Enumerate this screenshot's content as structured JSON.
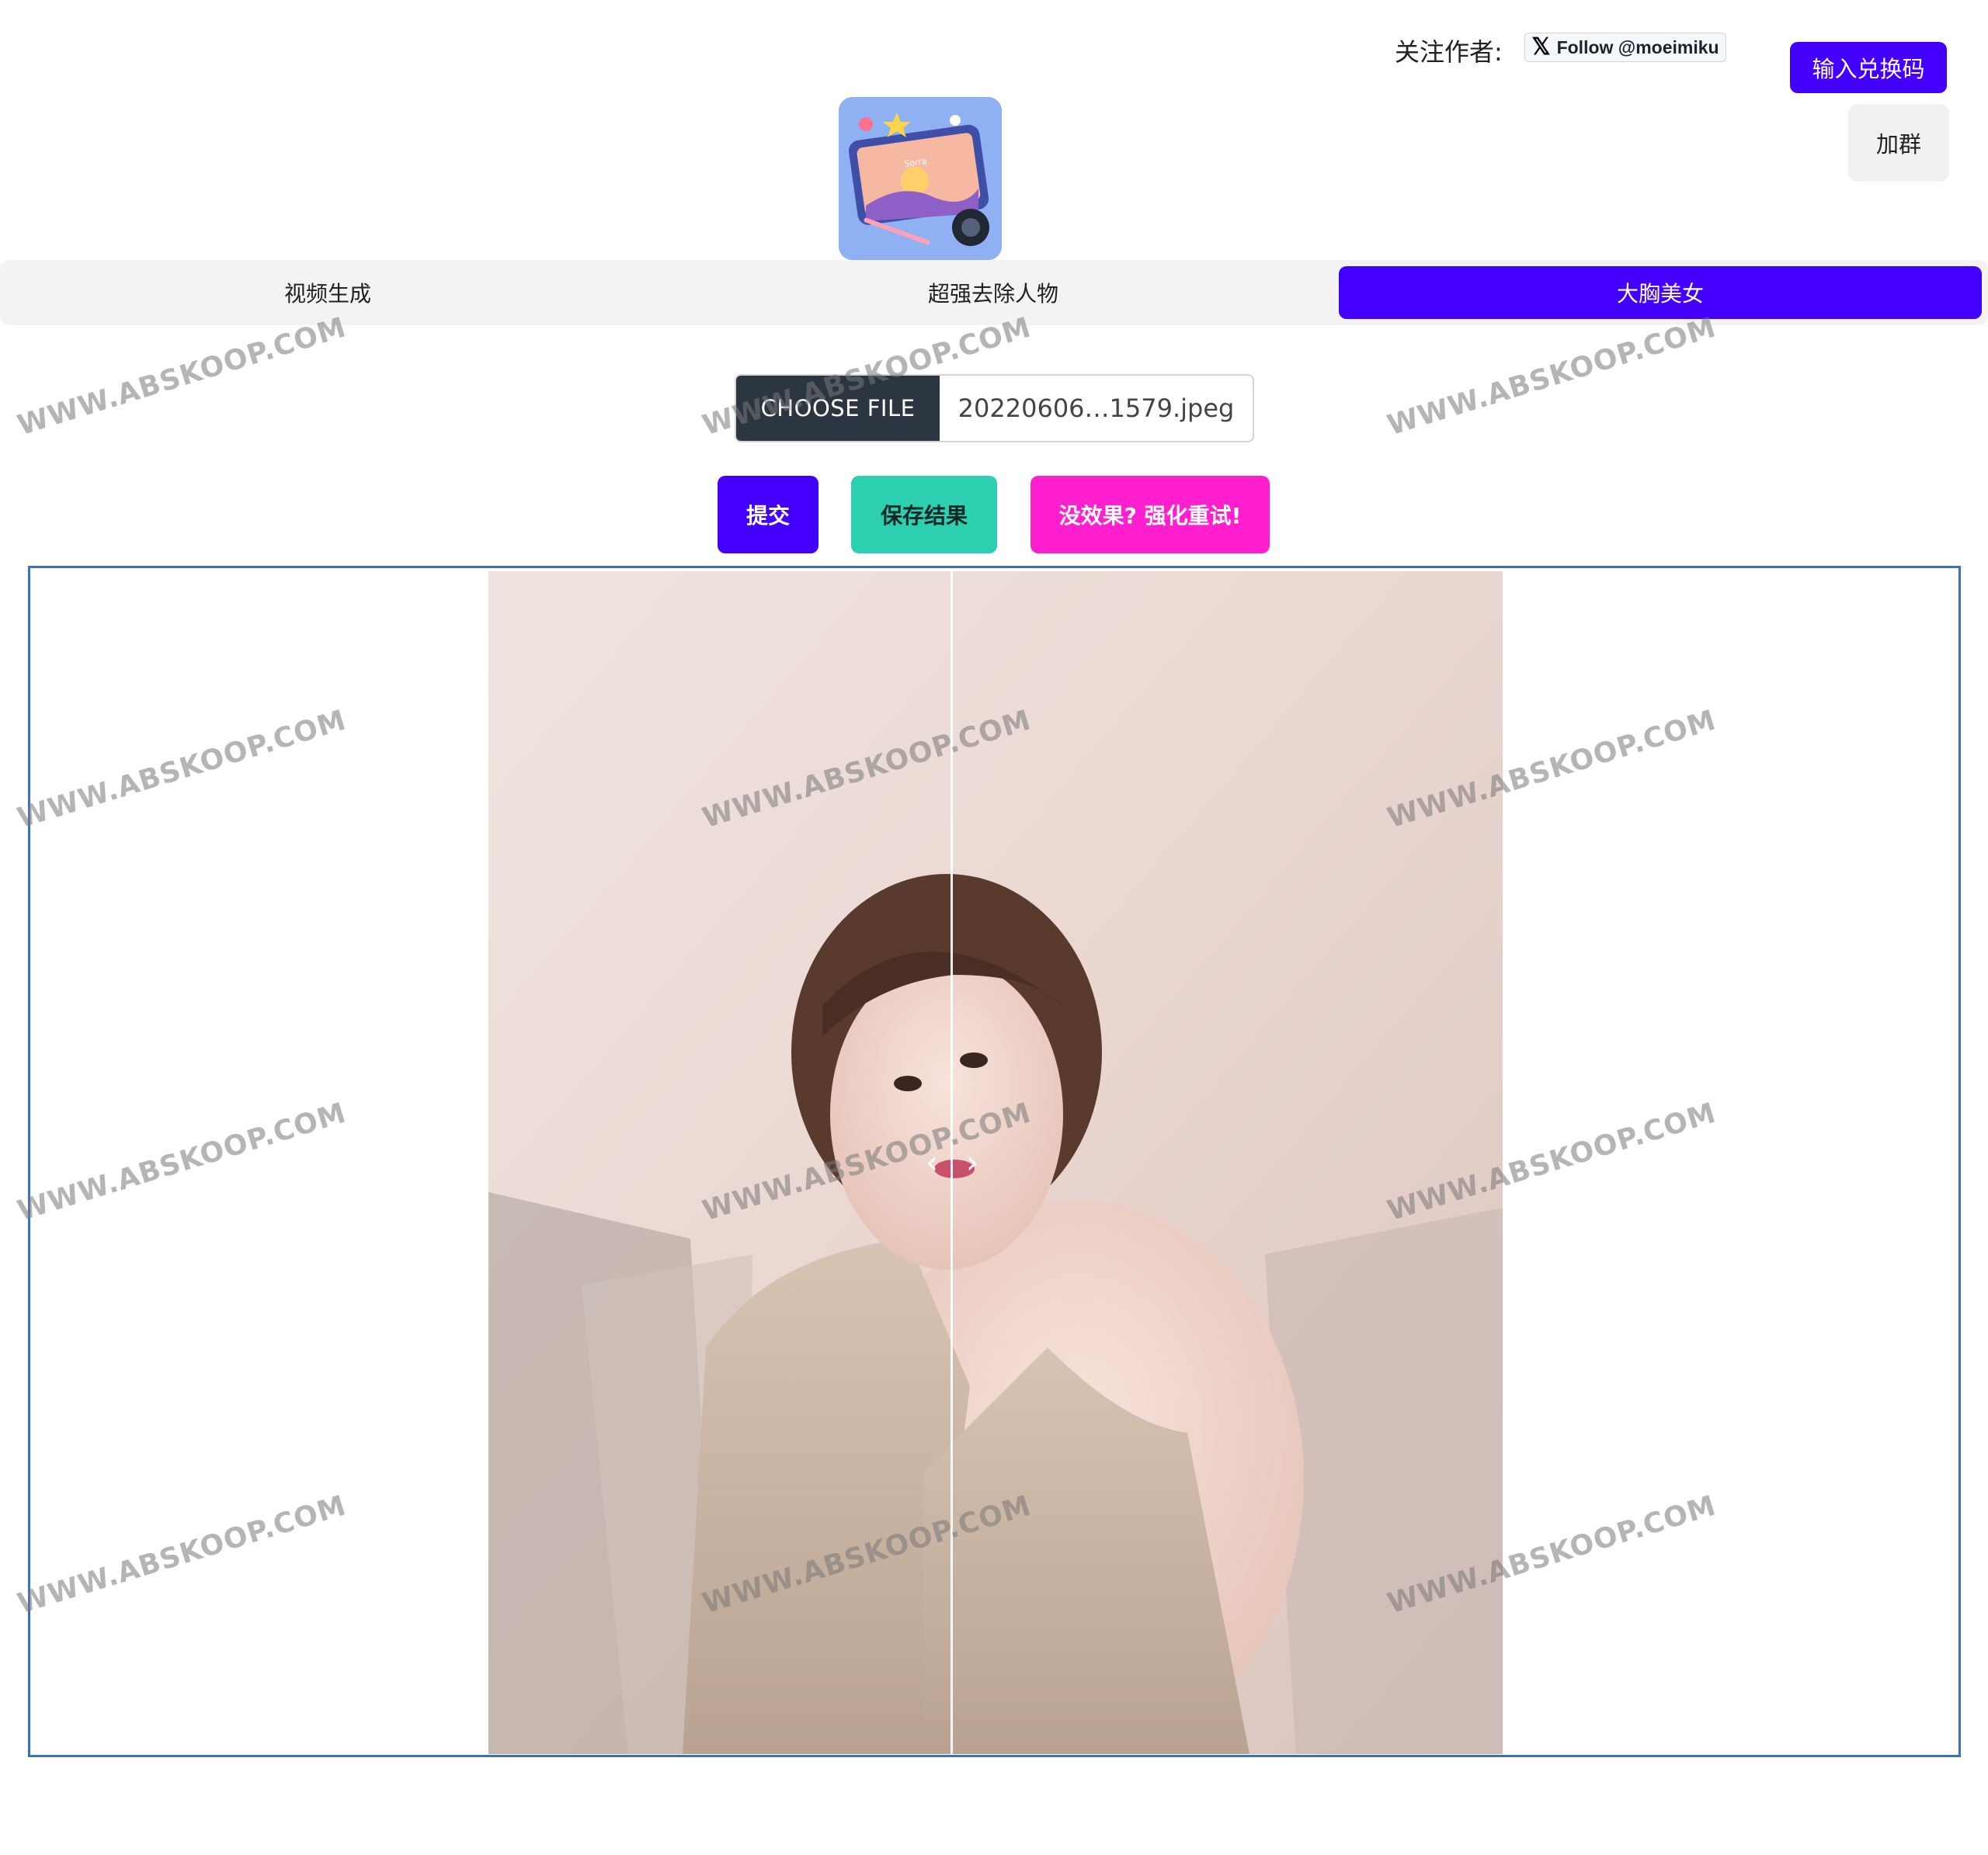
{
  "header": {
    "follow_label": "关注作者:",
    "x_follow_button": "Follow @moeimiku",
    "redeem_button": "输入兑换码",
    "group_button": "加群"
  },
  "logo": {
    "caption": "Sorra"
  },
  "tabs": [
    {
      "label": "视频生成",
      "active": false
    },
    {
      "label": "超强去除人物",
      "active": false
    },
    {
      "label": "大胸美女",
      "active": true
    }
  ],
  "file_input": {
    "button_label": "CHOOSE FILE",
    "file_name": "20220606…1579.jpeg"
  },
  "actions": {
    "submit": "提交",
    "save": "保存结果",
    "retry": "没效果? 强化重试!"
  },
  "compare": {
    "left_arrow": "‹",
    "right_arrow": "›"
  },
  "watermark": {
    "text": "WWW.ABSKOOP.COM"
  },
  "colors": {
    "accent": "#4400ff",
    "save": "#2ccfb0",
    "retry": "#ff1fcf",
    "file_button": "#2c3641",
    "viewer_border": "#3b6fc0"
  }
}
